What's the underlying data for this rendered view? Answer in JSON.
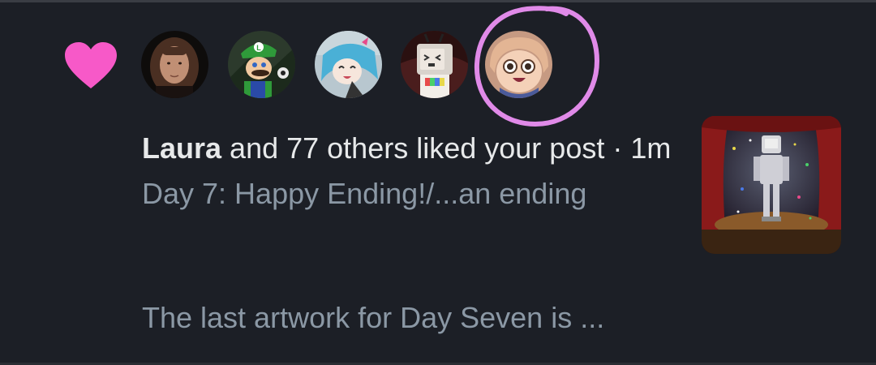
{
  "notification": {
    "type_icon": "heart-icon",
    "accent_color": "#f91880",
    "annotation_color": "#e08ae8",
    "avatars": [
      {
        "icon": "avatar-photo-person"
      },
      {
        "icon": "avatar-luigi-character"
      },
      {
        "icon": "avatar-anime-character"
      },
      {
        "icon": "avatar-tv-head-character"
      },
      {
        "icon": "avatar-cartoon-character"
      }
    ],
    "actor_name": "Laura",
    "action_text": " and 77 others liked your post",
    "separator": " · ",
    "time": "1m",
    "post_title": "Day 7: Happy Ending!/...an ending",
    "post_excerpt": "The last artwork for Day Seven is ...",
    "thumbnail": {
      "icon": "post-artwork-thumbnail"
    }
  }
}
